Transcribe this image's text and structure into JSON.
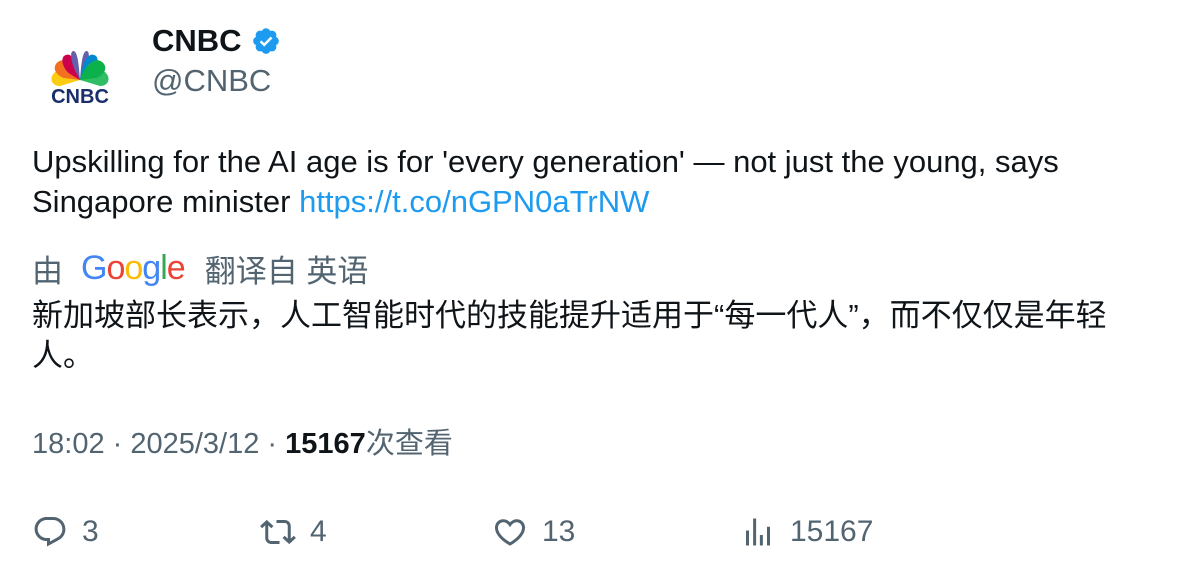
{
  "author": {
    "name": "CNBC",
    "handle": "@CNBC",
    "avatar_logo_text": "CNBC",
    "verified_icon": "verified-badge-icon"
  },
  "tweet": {
    "text": "Upskilling for the AI age is for 'every generation' — not just the young, says Singapore minister ",
    "link": "https://t.co/nGPN0aTrNW"
  },
  "translation": {
    "prefix": "由",
    "provider": "Google",
    "suffix": "翻译自 英语",
    "text": "新加坡部长表示，人工智能时代的技能提升适用于“每一代人”，而不仅仅是年轻人。"
  },
  "meta": {
    "time": "18:02",
    "separator1": " · ",
    "date": "2025/3/12",
    "separator2": " · ",
    "views": "15167",
    "views_label": "次查看"
  },
  "actions": {
    "replies": "3",
    "retweets": "4",
    "likes": "13",
    "views": "15167"
  },
  "colors": {
    "link": "#1d9bf0",
    "secondary_text": "#536471",
    "primary_text": "#0f1419",
    "verified": "#1d9bf0"
  }
}
